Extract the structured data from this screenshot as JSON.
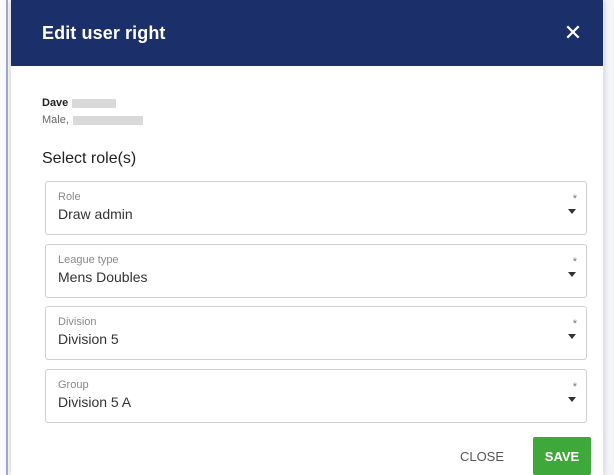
{
  "dialog": {
    "title": "Edit user right",
    "close_icon": "close-icon"
  },
  "user": {
    "name": "Dave",
    "details": "Male,"
  },
  "section_title": "Select role(s)",
  "fields": [
    {
      "label": "Role",
      "value": "Draw admin",
      "required_mark": "*"
    },
    {
      "label": "League type",
      "value": "Mens Doubles",
      "required_mark": "*"
    },
    {
      "label": "Division",
      "value": "Division 5",
      "required_mark": "*"
    },
    {
      "label": "Group",
      "value": "Division 5 A",
      "required_mark": "*"
    }
  ],
  "buttons": {
    "close": "CLOSE",
    "save": "SAVE"
  },
  "colors": {
    "header_bg": "#1b2f6b",
    "save_bg": "#3fa83a"
  }
}
